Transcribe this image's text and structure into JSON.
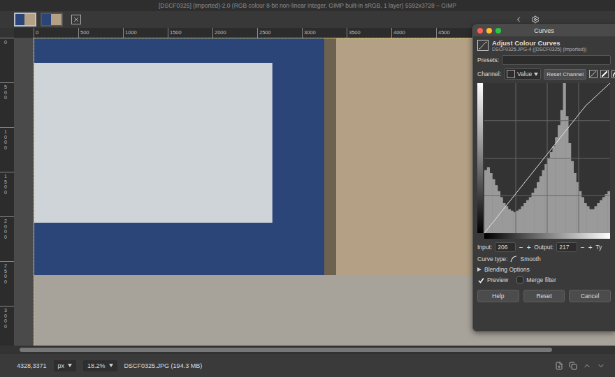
{
  "window": {
    "title": "[DSCF0325] (imported)-2.0 (RGB colour 8-bit non-linear integer, GIMP built-in sRGB, 1 layer) 5592x3728 – GIMP"
  },
  "image_tabs": [
    {
      "selected": true
    },
    {
      "selected": false
    }
  ],
  "rulers": {
    "horizontal": [
      "0",
      "500",
      "1000",
      "1500",
      "2000",
      "2500",
      "3000",
      "3500",
      "4000",
      "4500"
    ],
    "vertical": [
      "0",
      "500",
      "1000",
      "1500",
      "2000",
      "2500",
      "3000"
    ]
  },
  "status_bar": {
    "coords": "4328,3371",
    "unit": "px",
    "zoom": "18.2%",
    "file": "DSCF0325.JPG (194.3 MB)"
  },
  "curves_dialog": {
    "title": "Curves",
    "heading": "Adjust Colour Curves",
    "subtitle": "DSCF0325.JPG-4 ([DSCF0325] (imported))",
    "presets_label": "Presets:",
    "channel_label": "Channel:",
    "channel": "Value",
    "reset_channel": "Reset Channel",
    "histogram": [
      42,
      44,
      40,
      36,
      32,
      28,
      24,
      20,
      18,
      16,
      15,
      14,
      15,
      16,
      18,
      20,
      22,
      24,
      27,
      30,
      34,
      38,
      42,
      46,
      50,
      54,
      58,
      64,
      72,
      82,
      100,
      78,
      60,
      48,
      40,
      34,
      28,
      24,
      20,
      18,
      16,
      16,
      18,
      20,
      22,
      24,
      26,
      28
    ],
    "curve": [
      [
        0,
        0
      ],
      [
        206,
        217
      ],
      [
        255,
        255
      ]
    ],
    "input_label": "Input:",
    "input": "206",
    "output_label": "Output:",
    "output": "217",
    "minus": "−",
    "plus": "+",
    "type_label": "Ty",
    "curve_type_label": "Curve type:",
    "curve_type": "Smooth",
    "blending": {
      "label": "Blending Options",
      "expanded": false
    },
    "checkboxes": [
      {
        "label": "Preview",
        "checked": true
      },
      {
        "label": "Merge filter",
        "checked": false
      }
    ],
    "buttons": [
      "Help",
      "Reset",
      "Cancel"
    ]
  }
}
